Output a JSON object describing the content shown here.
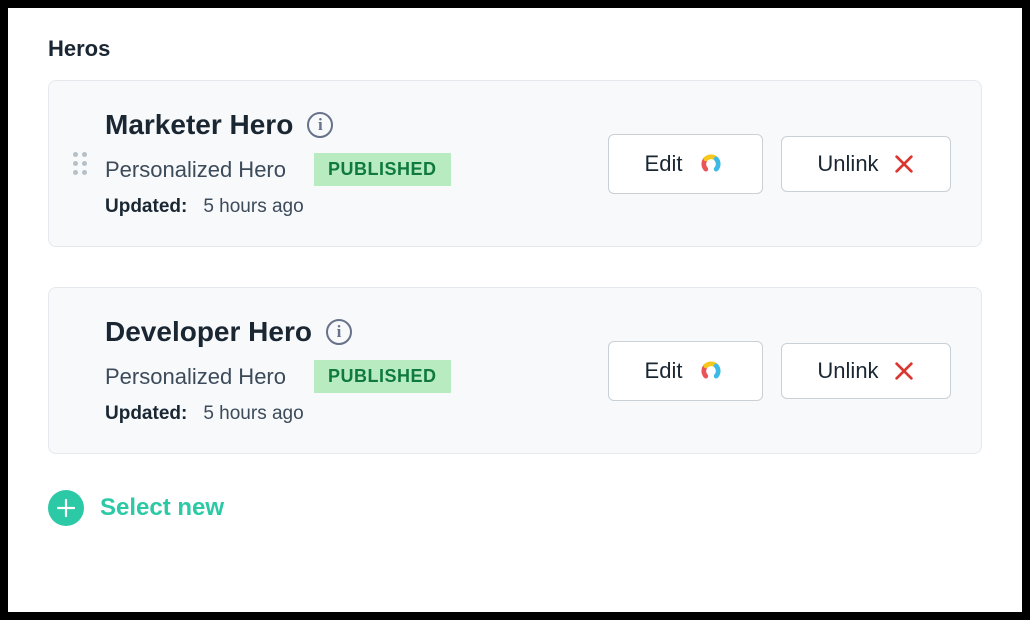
{
  "section_title": "Heros",
  "items": [
    {
      "title": "Marketer Hero",
      "subtitle": "Personalized Hero",
      "status": "PUBLISHED",
      "updated_label": "Updated:",
      "updated_value": "5 hours ago",
      "edit_label": "Edit",
      "unlink_label": "Unlink",
      "has_drag": true
    },
    {
      "title": "Developer Hero",
      "subtitle": "Personalized Hero",
      "status": "PUBLISHED",
      "updated_label": "Updated:",
      "updated_value": "5 hours ago",
      "edit_label": "Edit",
      "unlink_label": "Unlink",
      "has_drag": false
    }
  ],
  "select_new_label": "Select new",
  "colors": {
    "accent": "#2bc9a5",
    "status_bg": "#b9ebc0",
    "status_fg": "#0f7a3e",
    "danger": "#d9372f"
  }
}
